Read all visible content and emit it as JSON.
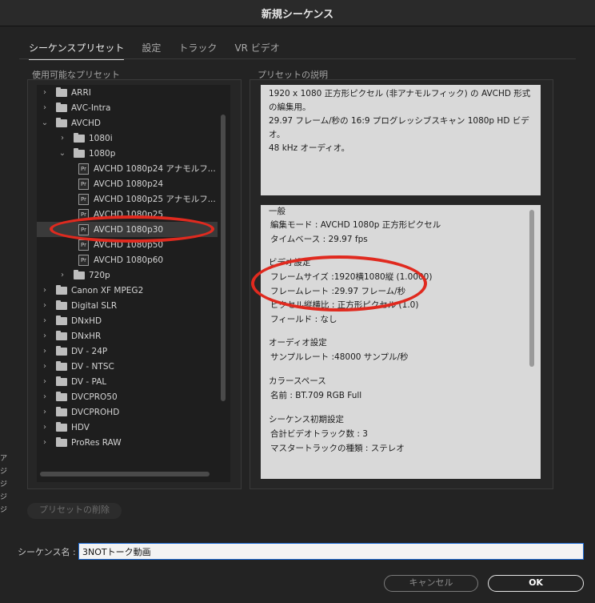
{
  "window": {
    "title": "新規シーケンス"
  },
  "tabs": [
    {
      "label": "シーケンスプリセット",
      "active": true
    },
    {
      "label": "設定"
    },
    {
      "label": "トラック"
    },
    {
      "label": "VR ビデオ"
    }
  ],
  "presets_panel": {
    "title": "使用可能なプリセット",
    "items": [
      {
        "label": "ARRI",
        "type": "folder",
        "expanded": false
      },
      {
        "label": "AVC-Intra",
        "type": "folder",
        "expanded": false
      },
      {
        "label": "AVCHD",
        "type": "folder",
        "expanded": true
      },
      {
        "label": "1080i",
        "type": "folder",
        "expanded": false
      },
      {
        "label": "1080p",
        "type": "folder",
        "expanded": true
      },
      {
        "label": "AVCHD 1080p24 アナモルフ...",
        "type": "preset"
      },
      {
        "label": "AVCHD 1080p24",
        "type": "preset"
      },
      {
        "label": "AVCHD 1080p25 アナモルフ...",
        "type": "preset"
      },
      {
        "label": "AVCHD 1080p25",
        "type": "preset"
      },
      {
        "label": "AVCHD 1080p30",
        "type": "preset",
        "selected": true
      },
      {
        "label": "AVCHD 1080p50",
        "type": "preset"
      },
      {
        "label": "AVCHD 1080p60",
        "type": "preset"
      },
      {
        "label": "720p",
        "type": "folder",
        "expanded": false
      },
      {
        "label": "Canon XF MPEG2",
        "type": "folder",
        "expanded": false
      },
      {
        "label": "Digital SLR",
        "type": "folder",
        "expanded": false
      },
      {
        "label": "DNxHD",
        "type": "folder",
        "expanded": false
      },
      {
        "label": "DNxHR",
        "type": "folder",
        "expanded": false
      },
      {
        "label": "DV - 24P",
        "type": "folder",
        "expanded": false
      },
      {
        "label": "DV - NTSC",
        "type": "folder",
        "expanded": false
      },
      {
        "label": "DV - PAL",
        "type": "folder",
        "expanded": false
      },
      {
        "label": "DVCPRO50",
        "type": "folder",
        "expanded": false
      },
      {
        "label": "DVCPROHD",
        "type": "folder",
        "expanded": false
      },
      {
        "label": "HDV",
        "type": "folder",
        "expanded": false
      },
      {
        "label": "ProRes RAW",
        "type": "folder",
        "expanded": false
      }
    ]
  },
  "description_panel": {
    "title": "プリセットの説明",
    "lines": [
      "1920 x 1080 正方形ピクセル (非アナモルフィック) の AVCHD 形式",
      "の編集用。",
      "29.97 フレーム/秒の 16:9 プログレッシブスキャン 1080p HD ビデ",
      "オ。",
      "48 kHz オーディオ。"
    ]
  },
  "details": {
    "lines": [
      "一般",
      " 編集モード : AVCHD 1080p 正方形ピクセル",
      " タイムベース : 29.97 fps",
      "ビデオ設定",
      " フレームサイズ :1920横1080縦 (1.0000)",
      " フレームレート :29.97  フレーム/秒",
      " ピクセル縦横比 : 正方形ピクセル (1.0)",
      " フィールド : なし",
      "オーディオ設定",
      " サンプルレート :48000 サンプル/秒",
      "カラースペース",
      " 名前 : BT.709 RGB Full",
      "シーケンス初期設定",
      " 合計ビデオトラック数 : 3",
      " マスタートラックの種類 : ステレオ"
    ]
  },
  "buttons": {
    "delete_preset": "プリセットの削除",
    "cancel": "キャンセル",
    "ok": "OK"
  },
  "sequence_name": {
    "label": "シーケンス名 :",
    "value": "3NOTトーク動画"
  },
  "edge_text": [
    "ア",
    "ジ",
    "ジ",
    "ジ",
    "ジ"
  ],
  "colors": {
    "annotation": "#e02a1f",
    "focus_border": "#1c6bd6"
  },
  "icons": {
    "folder": "folder-icon",
    "preset": "premiere-preset-icon",
    "expand": "chevron-right-icon",
    "collapse": "chevron-down-icon"
  }
}
